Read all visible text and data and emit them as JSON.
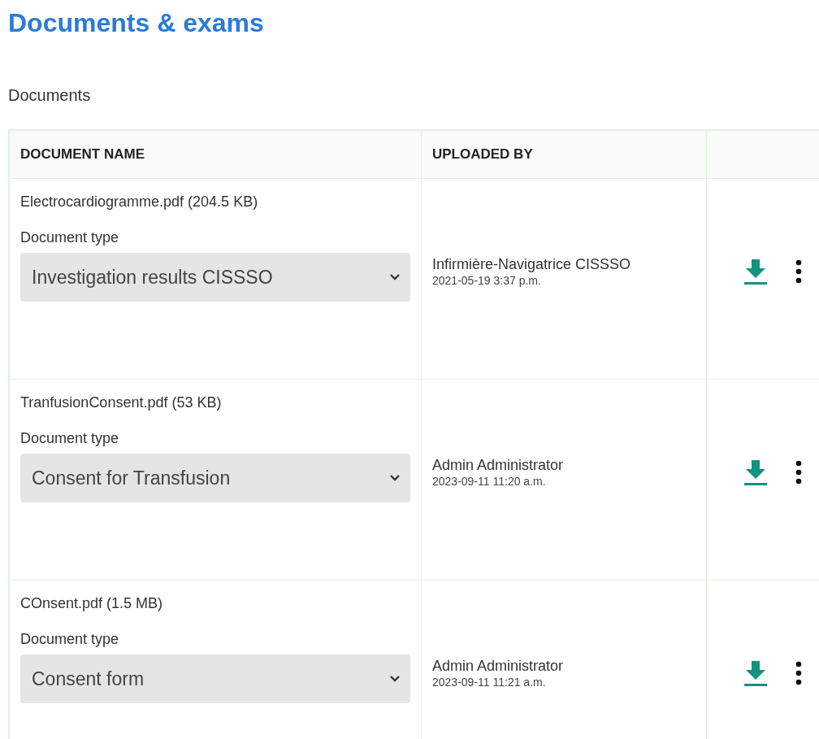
{
  "title": "Documents & exams",
  "section_label": "Documents",
  "table": {
    "columns": [
      "DOCUMENT NAME",
      "UPLOADED BY"
    ],
    "rows": [
      {
        "file": "Electrocardiogramme.pdf (204.5 KB)",
        "type_label": "Document type",
        "type_value": "Investigation results CISSSO",
        "uploader": "Infirmière-Navigatrice CISSSO",
        "uploaded_at": "2021-05-19 3:37 p.m."
      },
      {
        "file": "TranfusionConsent.pdf (53 KB)",
        "type_label": "Document type",
        "type_value": "Consent for Transfusion",
        "uploader": "Admin Administrator",
        "uploaded_at": "2023-09-11 11:20 a.m."
      },
      {
        "file": "COnsent.pdf (1.5 MB)",
        "type_label": "Document type",
        "type_value": "Consent form",
        "uploader": "Admin Administrator",
        "uploaded_at": "2023-09-11 11:21 a.m."
      }
    ]
  }
}
